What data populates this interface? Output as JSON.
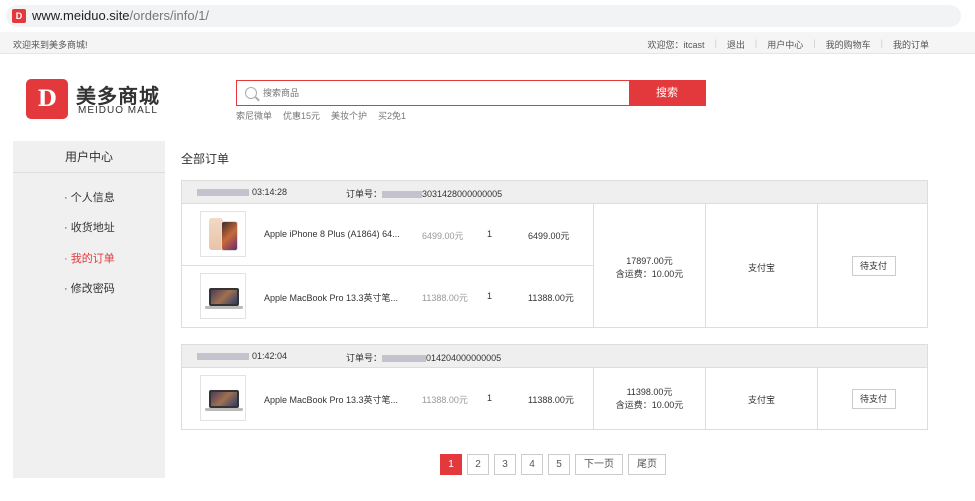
{
  "browser": {
    "url_host": "www.meiduo.site",
    "url_path": "/orders/info/1/",
    "favicon": "favicon-icon"
  },
  "topbar": {
    "welcome": "欢迎来到美多商城!",
    "greeting": "欢迎您：itcast",
    "logout": "退出",
    "user_center": "用户中心",
    "cart": "我的购物车",
    "my_orders": "我的订单"
  },
  "logo": {
    "cn": "美多商城",
    "en": "MEIDUO MALL",
    "mark": "D"
  },
  "search": {
    "placeholder": "搜索商品",
    "button": "搜索",
    "hotwords": [
      "索尼微单",
      "优惠15元",
      "美妆个护",
      "买2免1"
    ]
  },
  "sidebar": {
    "title": "用户中心",
    "items": [
      {
        "label": "个人信息"
      },
      {
        "label": "收货地址"
      },
      {
        "label": "我的订单"
      },
      {
        "label": "修改密码"
      }
    ]
  },
  "main": {
    "title": "全部订单"
  },
  "orders": [
    {
      "time": "03:14:28",
      "order_label": "订单号：",
      "order_no": "3031428000000005",
      "items": [
        {
          "name": "Apple iPhone 8 Plus (A1864) 64...",
          "price": "6499.00元",
          "qty": "1",
          "subtotal": "6499.00元"
        },
        {
          "name": "Apple MacBook Pro 13.3英寸笔...",
          "price": "11388.00元",
          "qty": "1",
          "subtotal": "11388.00元"
        }
      ],
      "total": "17897.00元",
      "freight": "含运费：10.00元",
      "pay_method": "支付宝",
      "status": "待支付"
    },
    {
      "time": "01:42:04",
      "order_label": "订单号：",
      "order_no": "014204000000005",
      "items": [
        {
          "name": "Apple MacBook Pro 13.3英寸笔...",
          "price": "11388.00元",
          "qty": "1",
          "subtotal": "11388.00元"
        }
      ],
      "total": "11398.00元",
      "freight": "含运费：10.00元",
      "pay_method": "支付宝",
      "status": "待支付"
    }
  ],
  "pager": {
    "pages": [
      "1",
      "2",
      "3",
      "4",
      "5"
    ],
    "next": "下一页",
    "last": "尾页",
    "current": "1"
  },
  "colors": {
    "accent": "#e4393c"
  }
}
